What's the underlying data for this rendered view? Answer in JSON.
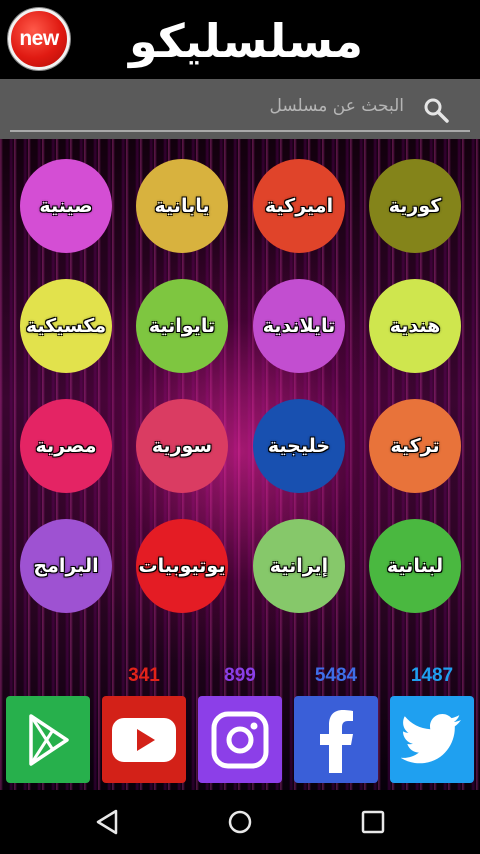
{
  "header": {
    "badge": "new",
    "title": "مسلسليكو"
  },
  "search": {
    "placeholder": "البحث عن مسلسل"
  },
  "categories": [
    {
      "label": "كورية",
      "color": "#84841a"
    },
    {
      "label": "اميركية",
      "color": "#e0442a"
    },
    {
      "label": "يابانية",
      "color": "#d8b23e"
    },
    {
      "label": "صينية",
      "color": "#d44ed4"
    },
    {
      "label": "هندية",
      "color": "#cfe64e"
    },
    {
      "label": "تايلاندية",
      "color": "#c24ed0"
    },
    {
      "label": "تايوانية",
      "color": "#7ec640"
    },
    {
      "label": "مكسيكية",
      "color": "#e2e24c"
    },
    {
      "label": "تركية",
      "color": "#e8733a"
    },
    {
      "label": "خليجية",
      "color": "#1850b0"
    },
    {
      "label": "سورية",
      "color": "#da3c62"
    },
    {
      "label": "مصرية",
      "color": "#e42464"
    },
    {
      "label": "لبنانية",
      "color": "#4ab840"
    },
    {
      "label": "إيرانية",
      "color": "#86c86a"
    },
    {
      "label": "يوتيوبيات",
      "color": "#e41c24"
    },
    {
      "label": "البرامج",
      "color": "#9e52d2"
    }
  ],
  "social": {
    "youtube_count": "341",
    "instagram_count": "899",
    "facebook_count": "5484",
    "twitter_count": "1487",
    "colors": {
      "play": "#27b04c",
      "youtube": "#d32118",
      "instagram": "#8c3fe8",
      "facebook": "#3a5fd8",
      "twitter": "#1fa0f0"
    },
    "count_colors": {
      "youtube": "#e2231a",
      "instagram": "#8a3fe6",
      "facebook": "#3f6ee8",
      "twitter": "#1f9ff0"
    }
  },
  "icons": [
    "search-icon",
    "google-play-icon",
    "youtube-icon",
    "instagram-icon",
    "facebook-icon",
    "twitter-icon",
    "back-icon",
    "home-icon",
    "recents-icon"
  ]
}
